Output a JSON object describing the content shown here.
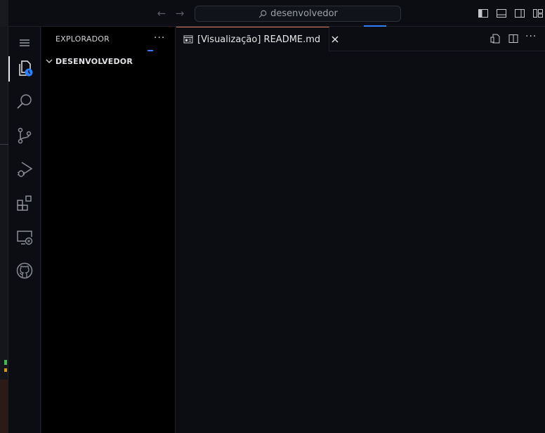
{
  "titlebar": {
    "search_text": "desenvolvedor",
    "back_icon": "arrow-left-icon",
    "forward_icon": "arrow-right-icon"
  },
  "activity_bar": {
    "items": [
      {
        "name": "menu",
        "icon": "hamburger-menu-icon"
      },
      {
        "name": "explorer",
        "icon": "files-icon",
        "active": true
      },
      {
        "name": "search",
        "icon": "search-icon"
      },
      {
        "name": "source-control",
        "icon": "source-control-icon"
      },
      {
        "name": "run-debug",
        "icon": "run-debug-icon"
      },
      {
        "name": "extensions",
        "icon": "extensions-icon"
      },
      {
        "name": "remote-explorer",
        "icon": "remote-explorer-icon"
      },
      {
        "name": "github",
        "icon": "github-icon"
      }
    ]
  },
  "sidebar": {
    "title": "EXPLORADOR",
    "more": "···",
    "folder": "DESENVOLVEDOR"
  },
  "editor": {
    "tab_label": "[Visualização] README.md",
    "more": "···"
  },
  "colors": {
    "accent": "#2f7fff",
    "tab_top_border": "#e07a5f",
    "background": "#0b0d12",
    "sidebar_background": "#000000"
  }
}
